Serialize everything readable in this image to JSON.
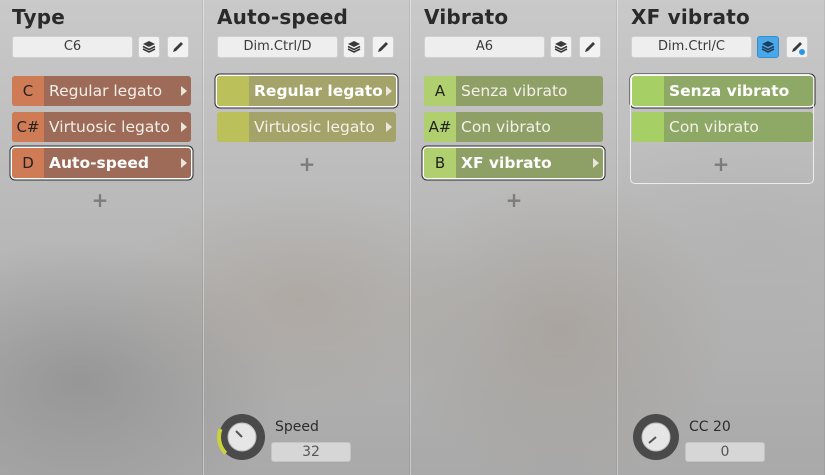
{
  "colors": {
    "type_key": "#cf7b55",
    "type_label": "#9e6b58",
    "autospeed_key": "#bcc05b",
    "autospeed_label": "#a4a36a",
    "vibrato_key": "#b0d070",
    "vibrato_label": "#8ea066",
    "xf_key": "#a6cf66",
    "xf_label": "#8ea866",
    "accent_blue": "#4aa8e8"
  },
  "columns": [
    {
      "title": "Type",
      "field": "C6",
      "layers_icon": "layers-icon",
      "edit_icon": "pencil-icon",
      "slots": [
        {
          "key": "C",
          "label": "Regular legato"
        },
        {
          "key": "C#",
          "label": "Virtuosic legato"
        },
        {
          "key": "D",
          "label": "Auto-speed"
        }
      ],
      "selected": "Auto-speed",
      "add_label": "+"
    },
    {
      "title": "Auto-speed",
      "field": "Dim.Ctrl/D",
      "slots": [
        {
          "key": "",
          "label": "Regular legato"
        },
        {
          "key": "",
          "label": "Virtuosic legato"
        }
      ],
      "selected": "Regular legato",
      "add_label": "+",
      "knob": {
        "caption": "Speed",
        "value": "32",
        "level": 0.25
      }
    },
    {
      "title": "Vibrato",
      "field": "A6",
      "slots": [
        {
          "key": "A",
          "label": "Senza vibrato"
        },
        {
          "key": "A#",
          "label": "Con vibrato"
        },
        {
          "key": "B",
          "label": "XF vibrato"
        }
      ],
      "selected": "XF vibrato",
      "add_label": "+"
    },
    {
      "title": "XF vibrato",
      "field": "Dim.Ctrl/C",
      "slots": [
        {
          "key": "",
          "label": "Senza vibrato"
        },
        {
          "key": "",
          "label": "Con vibrato"
        }
      ],
      "selected": "Senza vibrato",
      "add_label": "+",
      "knob": {
        "caption": "CC 20",
        "value": "0",
        "level": 0.0
      }
    }
  ]
}
